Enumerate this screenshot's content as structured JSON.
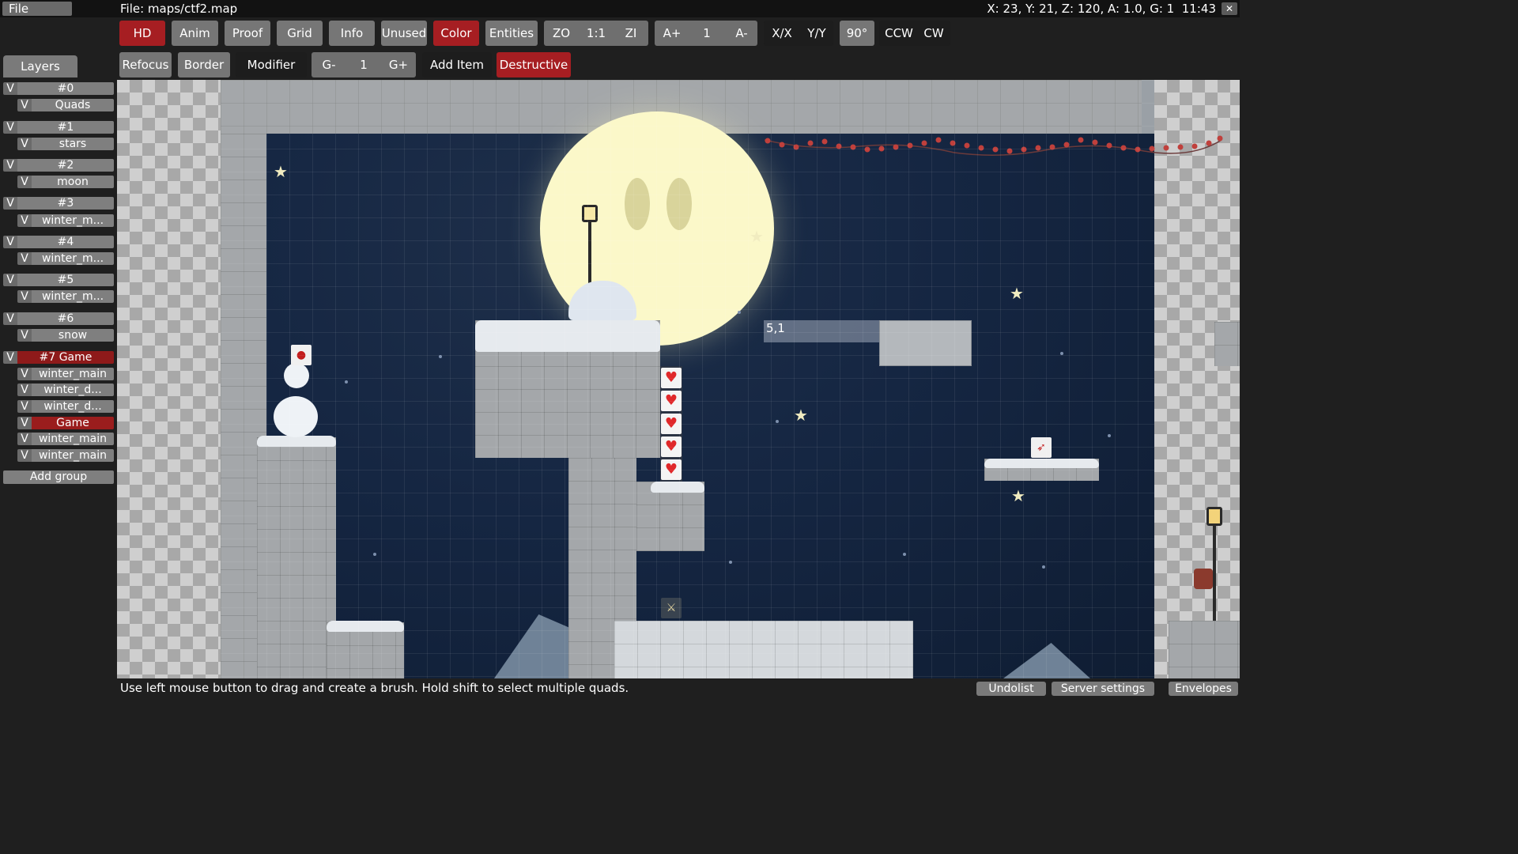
{
  "menu": {
    "file_label": "File",
    "title": "File: maps/ctf2.map",
    "status": "X: 23, Y: 21, Z: 120, A: 1.0, G: 1",
    "clock": "11:43",
    "close_label": "✕"
  },
  "toolbar_row1": {
    "hd": "HD",
    "anim": "Anim",
    "proof": "Proof",
    "grid": "Grid",
    "info": "Info",
    "unused": "Unused",
    "color": "Color",
    "entities": "Entities",
    "zo": "ZO",
    "one_to_one": "1:1",
    "zi": "ZI",
    "a_plus": "A+",
    "a_value": "1",
    "a_minus": "A-",
    "flip_x": "X/X",
    "flip_y": "Y/Y",
    "rotate_90": "90°",
    "ccw": "CCW",
    "cw": "CW"
  },
  "toolbar_row2": {
    "refocus": "Refocus",
    "border": "Border",
    "modifier": "Modifier",
    "g_minus": "G-",
    "g_value": "1",
    "g_plus": "G+",
    "add_item": "Add Item",
    "destructive": "Destructive"
  },
  "sidebar": {
    "tab": "Layers",
    "v": "V",
    "groups": [
      {
        "name": "#0",
        "layers": [
          "Quads"
        ]
      },
      {
        "name": "#1",
        "layers": [
          "stars"
        ]
      },
      {
        "name": "#2",
        "layers": [
          "moon"
        ]
      },
      {
        "name": "#3",
        "layers": [
          "winter_m..."
        ]
      },
      {
        "name": "#4",
        "layers": [
          "winter_m..."
        ]
      },
      {
        "name": "#5",
        "layers": [
          "winter_m..."
        ]
      },
      {
        "name": "#6",
        "layers": [
          "snow"
        ]
      },
      {
        "name": "#7 Game",
        "layers": [
          "winter_main",
          "winter_d...",
          "winter_d...",
          "Game",
          "winter_main",
          "winter_main"
        ]
      }
    ],
    "add_group": "Add group"
  },
  "viewport": {
    "brush_label": "5,1"
  },
  "bottom": {
    "hint": "Use left mouse button to drag and create a brush. Hold shift to select multiple quads.",
    "undolist": "Undolist",
    "server_settings": "Server settings",
    "envelopes": "Envelopes"
  },
  "colors": {
    "accent_red": "#a61e22",
    "button_gray": "#767676",
    "sky": "#152642",
    "moon": "#fbf8c9"
  }
}
